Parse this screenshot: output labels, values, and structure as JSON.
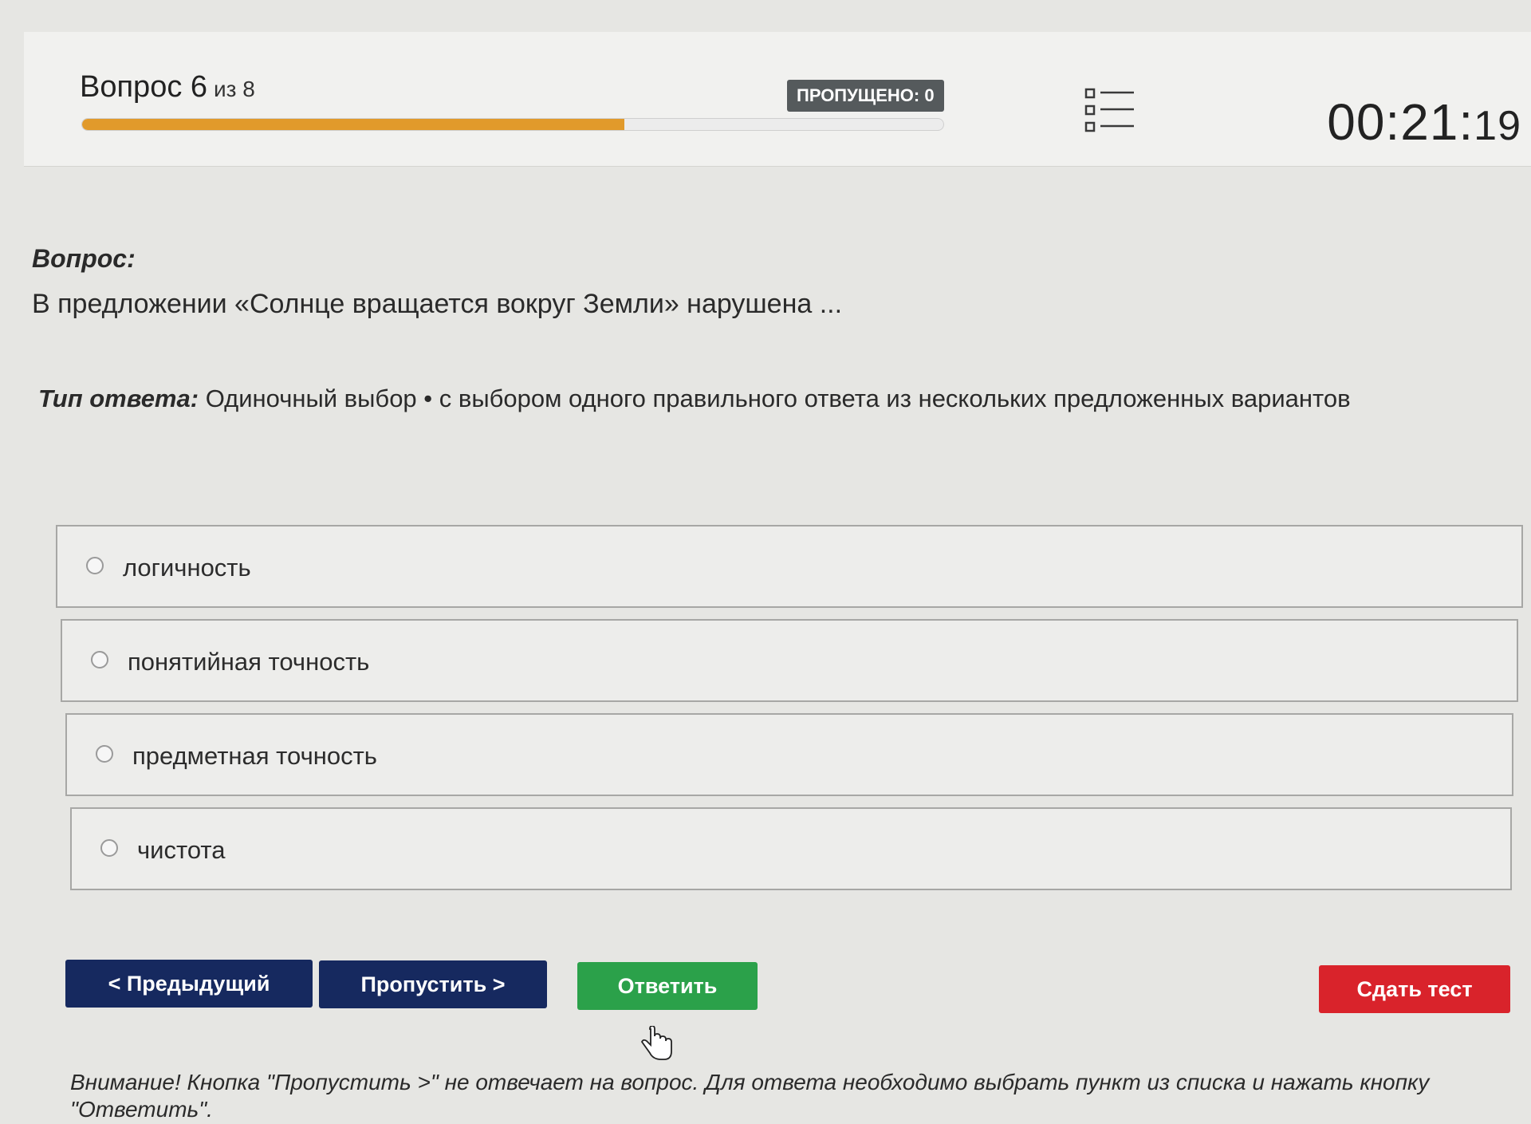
{
  "header": {
    "question_label": "Вопрос 6",
    "question_of": "из 8",
    "progress": 0.63,
    "skipped_badge": "ПРОПУЩЕНО: 0",
    "list_icon": "list-icon",
    "timer_main": "00:21:",
    "timer_seconds": "19"
  },
  "question": {
    "label": "Вопрос:",
    "text": "В предложении «Солнце вращается вокруг Земли» нарушена ...",
    "answer_type_label": "Тип ответа:",
    "answer_type_value": "Одиночный выбор • с выбором одного правильного ответа из нескольких предложенных вариантов"
  },
  "options": [
    {
      "label": "логичность"
    },
    {
      "label": "понятийная точность"
    },
    {
      "label": "предметная точность"
    },
    {
      "label": "чистота"
    }
  ],
  "buttons": {
    "previous": "< Предыдущий",
    "skip": "Пропустить >",
    "answer": "Ответить",
    "submit": "Сдать тест"
  },
  "notice": "Внимание! Кнопка \"Пропустить >\" не отвечает на вопрос. Для ответа необходимо выбрать пункт из списка и нажать кнопку \"Ответить\".",
  "colors": {
    "progress": "#e19a2b",
    "nav_button": "#16295f",
    "answer_button": "#2ba14a",
    "submit_button": "#d9232b",
    "badge": "#555a5c"
  }
}
